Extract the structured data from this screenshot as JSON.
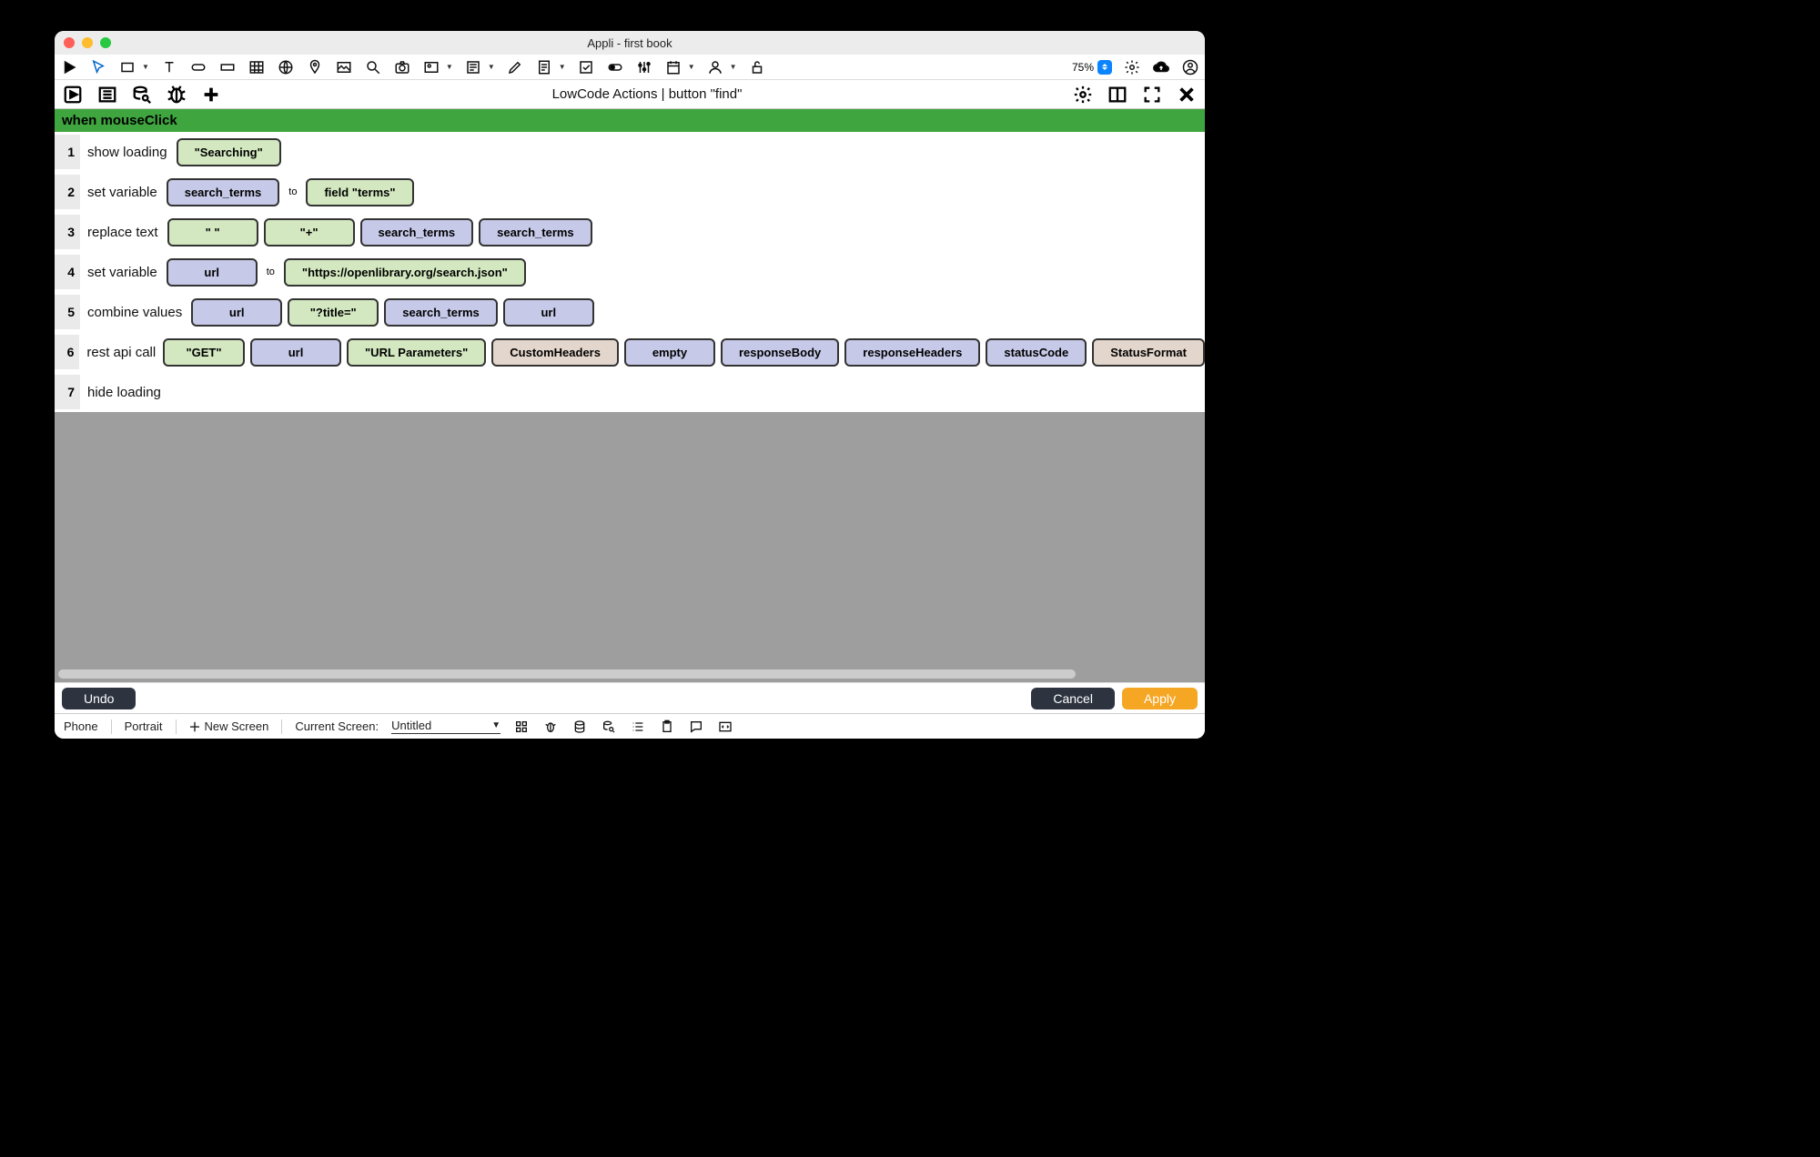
{
  "window": {
    "title": "Appli - first book"
  },
  "toolbar": {
    "zoom": "75%"
  },
  "subtoolbar": {
    "title": "LowCode Actions | button \"find\""
  },
  "trigger": "when mouseClick",
  "lines": {
    "l1": {
      "no": "1",
      "label": "show loading",
      "t1": "\"Searching\""
    },
    "l2": {
      "no": "2",
      "label": "set variable",
      "t1": "search_terms",
      "mid": "to",
      "t2": "field \"terms\""
    },
    "l3": {
      "no": "3",
      "label": "replace text",
      "t1": "\" \"",
      "t2": "\"+\"",
      "t3": "search_terms",
      "t4": "search_terms"
    },
    "l4": {
      "no": "4",
      "label": "set variable",
      "t1": "url",
      "mid": "to",
      "t2": "\"https://openlibrary.org/search.json\""
    },
    "l5": {
      "no": "5",
      "label": "combine values",
      "t1": "url",
      "t2": "\"?title=\"",
      "t3": "search_terms",
      "t4": "url"
    },
    "l6": {
      "no": "6",
      "label": "rest api call",
      "t1": "\"GET\"",
      "t2": "url",
      "t3": "\"URL Parameters\"",
      "t4": "CustomHeaders",
      "t5": "empty",
      "t6": "responseBody",
      "t7": "responseHeaders",
      "t8": "statusCode",
      "t9": "StatusFormat"
    },
    "l7": {
      "no": "7",
      "label": "hide loading"
    }
  },
  "footer": {
    "undo": "Undo",
    "cancel": "Cancel",
    "apply": "Apply"
  },
  "status": {
    "device": "Phone",
    "orientation": "Portrait",
    "new_screen": "New Screen",
    "current_screen_label": "Current Screen:",
    "current_screen_value": "Untitled"
  }
}
